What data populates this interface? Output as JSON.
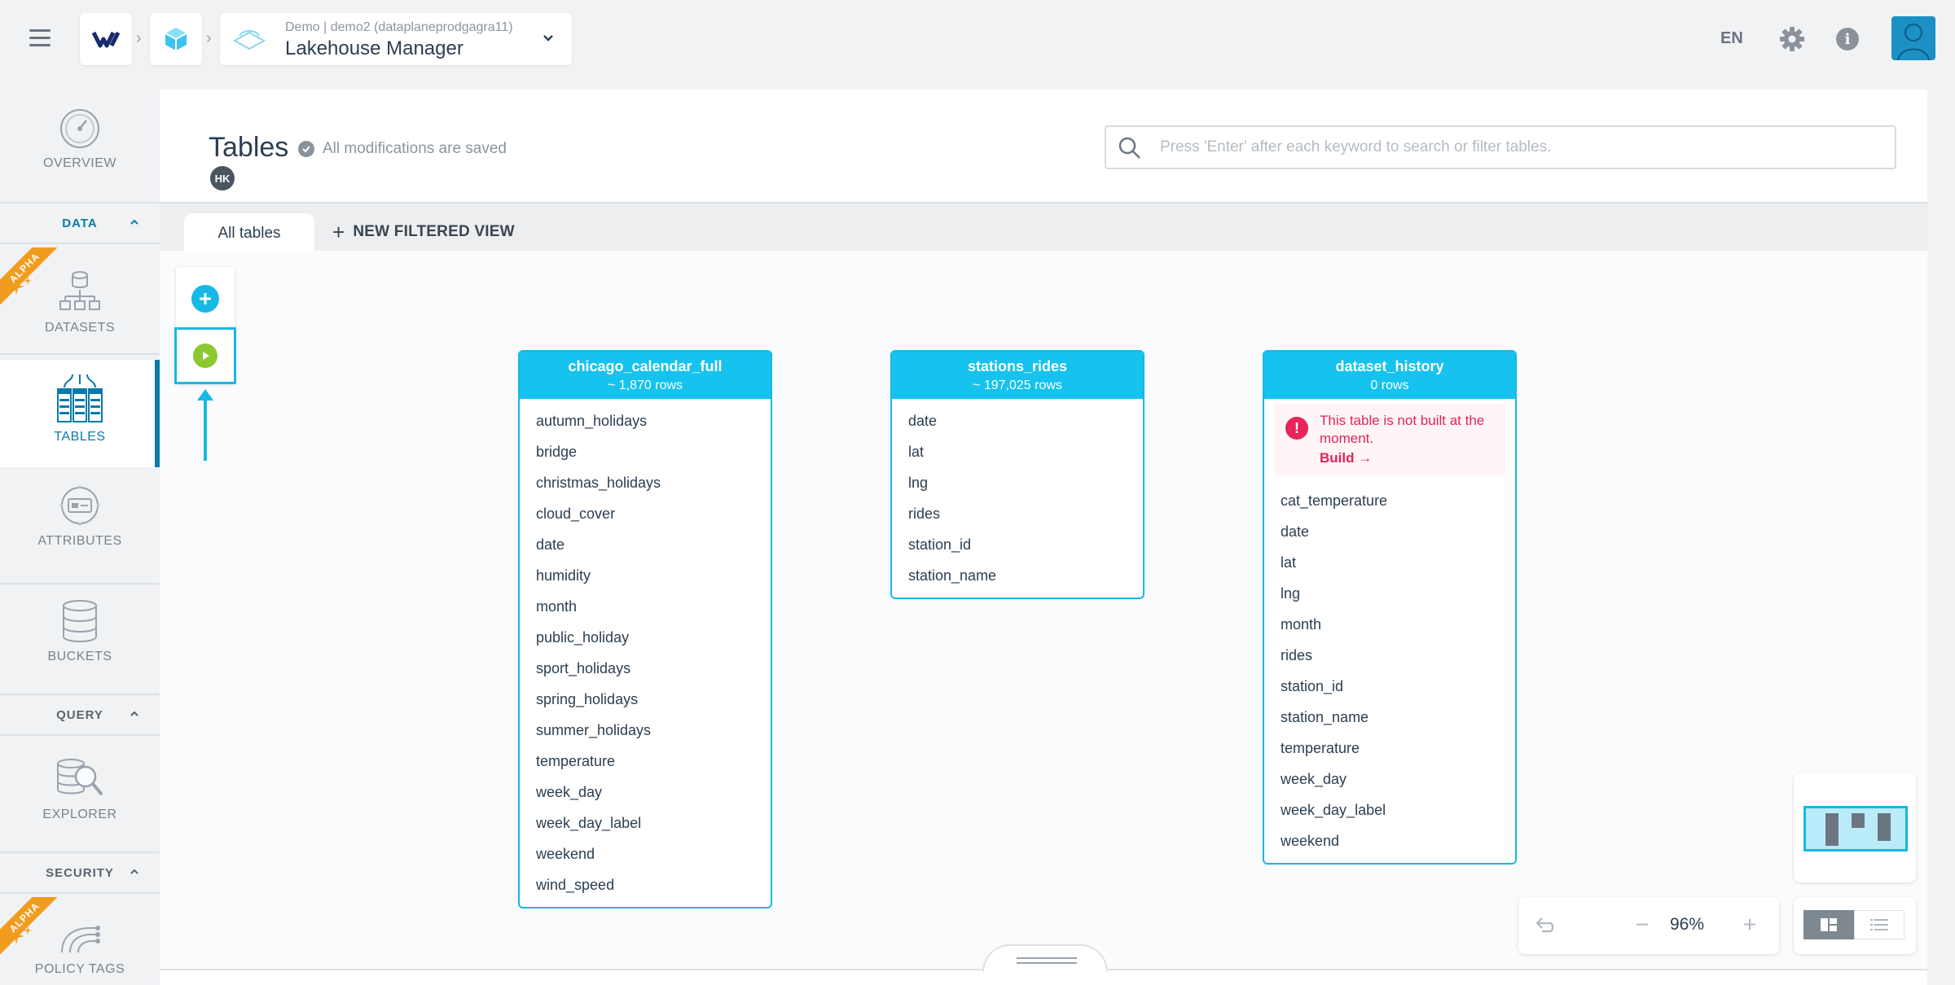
{
  "topbar": {
    "breadcrumb": {
      "context": "Demo | demo2 (dataplaneprodgagra11)",
      "title": "Lakehouse Manager"
    },
    "language": "EN"
  },
  "sidebar": {
    "overview": "OVERVIEW",
    "data_section": "DATA",
    "alpha_label": "ALPHA",
    "datasets": "DATASETS",
    "tables": "TABLES",
    "attributes": "ATTRIBUTES",
    "buckets": "BUCKETS",
    "query_section": "QUERY",
    "explorer": "EXPLORER",
    "security_section": "SECURITY",
    "policy_tags": "POLICY TAGS"
  },
  "main": {
    "title": "Tables",
    "saved_status": "All modifications are saved",
    "user_initials": "HK",
    "search_placeholder": "Press 'Enter' after each keyword to search or filter tables.",
    "tabs": {
      "all_tables": "All tables",
      "new_filtered_view": "NEW FILTERED VIEW"
    }
  },
  "tables": [
    {
      "name": "chicago_calendar_full",
      "rows": "~ 1,870 rows",
      "columns": [
        "autumn_holidays",
        "bridge",
        "christmas_holidays",
        "cloud_cover",
        "date",
        "humidity",
        "month",
        "public_holiday",
        "sport_holidays",
        "spring_holidays",
        "summer_holidays",
        "temperature",
        "week_day",
        "week_day_label",
        "weekend",
        "wind_speed"
      ]
    },
    {
      "name": "stations_rides",
      "rows": "~ 197,025 rows",
      "columns": [
        "date",
        "lat",
        "lng",
        "rides",
        "station_id",
        "station_name"
      ]
    },
    {
      "name": "dataset_history",
      "rows": "0 rows",
      "warning": "This table is not built at the moment.",
      "build_label": "Build →",
      "columns": [
        "cat_temperature",
        "date",
        "lat",
        "lng",
        "month",
        "rides",
        "station_id",
        "station_name",
        "temperature",
        "week_day",
        "week_day_label",
        "weekend"
      ]
    }
  ],
  "zoom": {
    "level": "96%",
    "minus": "−",
    "plus": "+"
  },
  "colors": {
    "accent": "#16b8e6",
    "nav_active": "#0a7aa8",
    "run_green": "#8cc832",
    "warning": "#e0245e",
    "alpha_ribbon": "#f29c1f"
  }
}
